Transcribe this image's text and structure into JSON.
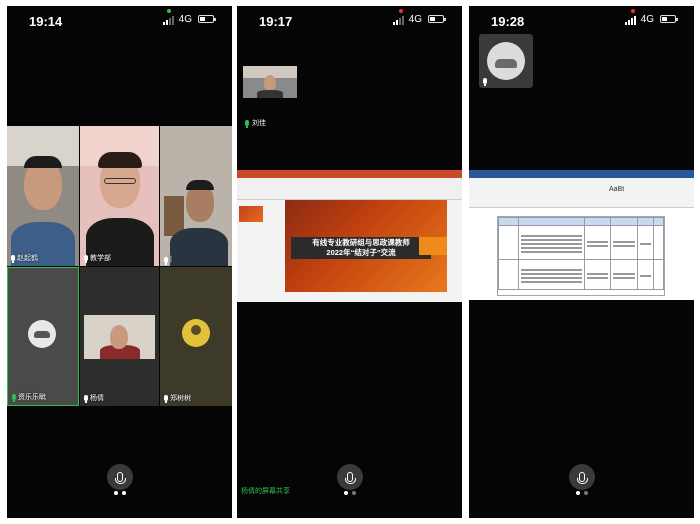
{
  "screens": [
    {
      "time": "19:14",
      "network": "4G",
      "participants": [
        {
          "name": "赵起鹤"
        },
        {
          "name": "教学部"
        },
        {
          "name": "|"
        },
        {
          "name": "资乐乐眦"
        },
        {
          "name": "杨倩"
        },
        {
          "name": "郑树树"
        }
      ]
    },
    {
      "time": "19:17",
      "network": "4G",
      "presenter_name": "刘佳",
      "slide_title_line1": "有线专业教研组与思政课教师",
      "slide_title_line2": "2022年“结对子”交流",
      "share_status": "杨倩的屏幕共享"
    },
    {
      "time": "19:28",
      "network": "4G",
      "word_font_label": "AaBt"
    }
  ],
  "colors": {
    "speaking_border": "#2fbf4e",
    "slide_orange": "#e9781c",
    "word_blue": "#2b579a"
  },
  "icons": [
    "signal-icon",
    "battery-icon",
    "mic-icon",
    "avatar-icon",
    "car-icon"
  ]
}
